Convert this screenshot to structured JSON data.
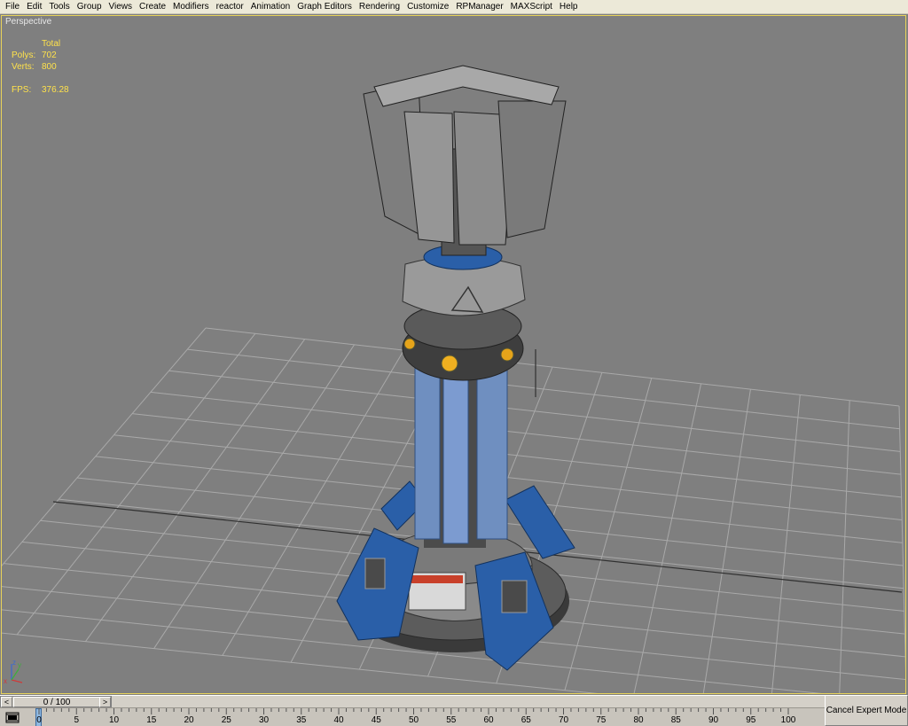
{
  "menu": [
    "File",
    "Edit",
    "Tools",
    "Group",
    "Views",
    "Create",
    "Modifiers",
    "reactor",
    "Animation",
    "Graph Editors",
    "Rendering",
    "Customize",
    "RPManager",
    "MAXScript",
    "Help"
  ],
  "viewport": {
    "label": "Perspective",
    "stats": {
      "header": "Total",
      "polys_label": "Polys:",
      "polys_value": "702",
      "verts_label": "Verts:",
      "verts_value": "800",
      "fps_label": "FPS:",
      "fps_value": "376.28"
    },
    "axis_labels": {
      "x": "x",
      "y": "y",
      "z": "z"
    }
  },
  "timeline": {
    "slider_value": "0 / 100",
    "left_arrow": "<",
    "right_arrow": ">",
    "ticks": [
      "0",
      "5",
      "10",
      "15",
      "20",
      "25",
      "30",
      "35",
      "40",
      "45",
      "50",
      "55",
      "60",
      "65",
      "70",
      "75",
      "80",
      "85",
      "90",
      "95",
      "100"
    ]
  },
  "expert_button": "Cancel Expert Mode",
  "colors": {
    "viewport_bg": "#7f7f7f",
    "grid": "#b2b2b2",
    "stats_text": "#ffe24b",
    "active_border": "#e8d35a",
    "accent_blue": "#2a5fa8"
  },
  "icons": {
    "track_bar": "filmstrip-icon",
    "axis": "axis-tripod-icon"
  }
}
